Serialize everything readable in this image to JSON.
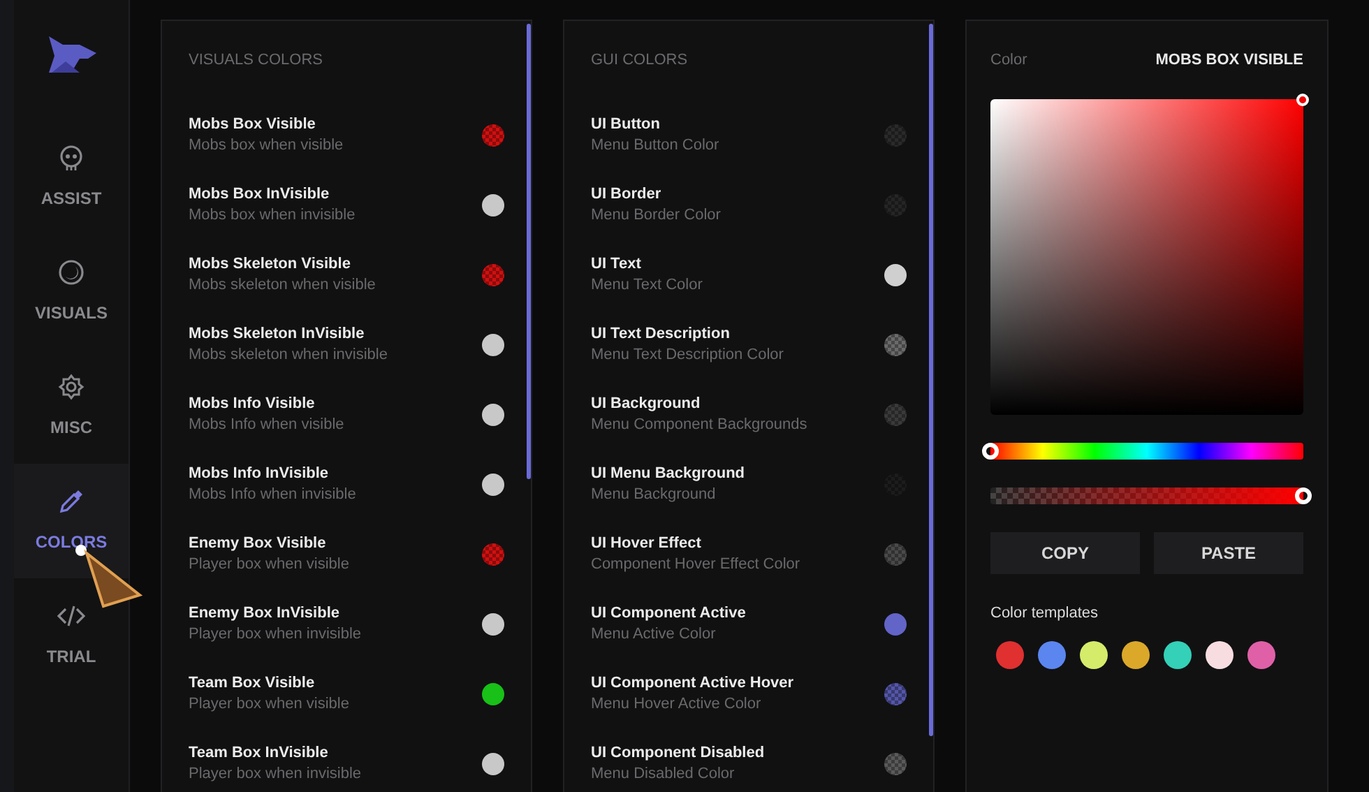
{
  "sidebar": {
    "items": [
      {
        "label": "ASSIST",
        "kind": "skull",
        "selected": false
      },
      {
        "label": "VISUALS",
        "kind": "moon",
        "selected": false
      },
      {
        "label": "MISC",
        "kind": "gear",
        "selected": false
      },
      {
        "label": "COLORS",
        "kind": "dropper",
        "selected": true
      },
      {
        "label": "TRIAL",
        "kind": "code",
        "selected": false
      }
    ]
  },
  "panels": [
    {
      "title": "VISUALS COLORS",
      "items": [
        {
          "name": "Mobs Box Visible",
          "description": "Mobs box when visible",
          "color": "#d01010",
          "kind": "checkered"
        },
        {
          "name": "Mobs Box InVisible",
          "description": "Mobs box when invisible",
          "color": "#c8c8c8",
          "kind": "solid"
        },
        {
          "name": "Mobs Skeleton Visible",
          "description": "Mobs skeleton when visible",
          "color": "#d01010",
          "kind": "checkered"
        },
        {
          "name": "Mobs Skeleton InVisible",
          "description": "Mobs skeleton when invisible",
          "color": "#c8c8c8",
          "kind": "solid"
        },
        {
          "name": "Mobs Info Visible",
          "description": "Mobs Info when visible",
          "color": "#c8c8c8",
          "kind": "solid"
        },
        {
          "name": "Mobs Info InVisible",
          "description": "Mobs Info when invisible",
          "color": "#c8c8c8",
          "kind": "solid"
        },
        {
          "name": "Enemy Box Visible",
          "description": "Player box when visible",
          "color": "#d01010",
          "kind": "checkered"
        },
        {
          "name": "Enemy Box InVisible",
          "description": "Player box when invisible",
          "color": "#c8c8c8",
          "kind": "solid"
        },
        {
          "name": "Team Box Visible",
          "description": "Player box when visible",
          "color": "#18c018",
          "kind": "solid"
        },
        {
          "name": "Team Box InVisible",
          "description": "Player box when invisible",
          "color": "#c8c8c8",
          "kind": "solid"
        }
      ]
    },
    {
      "title": "GUI COLORS",
      "items": [
        {
          "name": "UI Button",
          "description": "Menu Button Color",
          "color": "#2a2a2a",
          "kind": "checkered"
        },
        {
          "name": "UI Border",
          "description": "Menu Border Color",
          "color": "#252525",
          "kind": "checkered"
        },
        {
          "name": "UI Text",
          "description": "Menu Text Color",
          "color": "#cfcfcf",
          "kind": "solid"
        },
        {
          "name": "UI Text Description",
          "description": "Menu Text Description Color",
          "color": "#6a6a6a",
          "kind": "checkered"
        },
        {
          "name": "UI Background",
          "description": "Menu Component Backgrounds",
          "color": "#3a3a3a",
          "kind": "checkered"
        },
        {
          "name": "UI Menu Background",
          "description": "Menu Background",
          "color": "#1c1c1c",
          "kind": "checkered"
        },
        {
          "name": "UI Hover Effect",
          "description": "Component Hover Effect Color",
          "color": "#4a4a4a",
          "kind": "checkered"
        },
        {
          "name": "UI Component Active",
          "description": "Menu Active Color",
          "color": "#6264c8",
          "kind": "solid"
        },
        {
          "name": "UI Component Active Hover",
          "description": "Menu Hover Active Color",
          "color": "#5456a8",
          "kind": "checkered"
        },
        {
          "name": "UI Component Disabled",
          "description": "Menu Disabled Color",
          "color": "#5a5a5a",
          "kind": "checkered"
        }
      ]
    }
  ],
  "picker": {
    "label": "Color",
    "target": "MOBS BOX VISIBLE",
    "hue": {
      "level": 0
    },
    "alpha": {
      "level": 1
    },
    "buttons": [
      "COPY",
      "PASTE"
    ],
    "templates_label": "Color templates",
    "templates": [
      {
        "color": "#e03030"
      },
      {
        "color": "#5b86f0"
      },
      {
        "color": "#d4ec6a"
      },
      {
        "color": "#dca82a"
      },
      {
        "color": "#34d0b8"
      },
      {
        "color": "#f8dde0"
      },
      {
        "color": "#e060a8"
      }
    ]
  }
}
